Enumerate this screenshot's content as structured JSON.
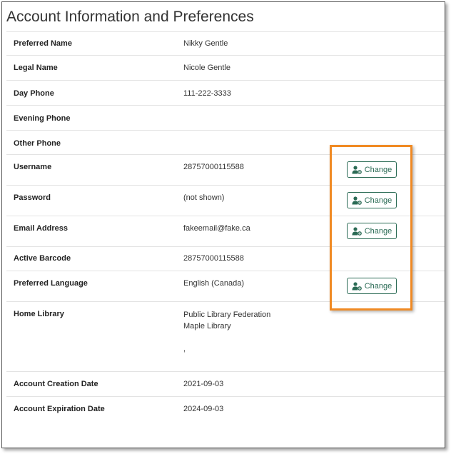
{
  "page": {
    "title": "Account Information and Preferences"
  },
  "fields": {
    "preferred_name": {
      "label": "Preferred Name",
      "value": "Nikky Gentle"
    },
    "legal_name": {
      "label": "Legal Name",
      "value": "Nicole Gentle"
    },
    "day_phone": {
      "label": "Day Phone",
      "value": "111-222-3333"
    },
    "evening_phone": {
      "label": "Evening Phone",
      "value": ""
    },
    "other_phone": {
      "label": "Other Phone",
      "value": ""
    },
    "username": {
      "label": "Username",
      "value": "28757000115588"
    },
    "password": {
      "label": "Password",
      "value": "(not shown)"
    },
    "email": {
      "label": "Email Address",
      "value": "fakeemail@fake.ca"
    },
    "active_barcode": {
      "label": "Active Barcode",
      "value": "28757000115588"
    },
    "preferred_language": {
      "label": "Preferred Language",
      "value": "English (Canada)"
    },
    "home_library": {
      "label": "Home Library",
      "line1": "Public Library Federation",
      "line2": "Maple Library",
      "line3": ","
    },
    "creation_date": {
      "label": "Account Creation Date",
      "value": "2021-09-03"
    },
    "expiration_date": {
      "label": "Account Expiration Date",
      "value": "2024-09-03"
    }
  },
  "buttons": {
    "change_label": "Change",
    "icon": "user-gear-icon",
    "color": "#2b6b55"
  },
  "annotation": {
    "highlight_color": "#f08a24"
  }
}
